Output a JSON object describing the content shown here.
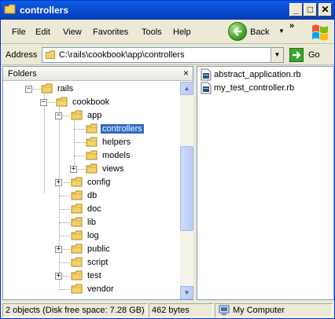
{
  "window": {
    "title": "controllers"
  },
  "title_buttons": {
    "minimize": "_",
    "maximize": "□",
    "close": "✕"
  },
  "menu": {
    "items": [
      "File",
      "Edit",
      "View",
      "Favorites",
      "Tools",
      "Help"
    ]
  },
  "toolbar": {
    "back_label": "Back",
    "more": "»"
  },
  "address": {
    "label": "Address",
    "value": "C:\\rails\\cookbook\\app\\controllers",
    "go_label": "Go"
  },
  "folders": {
    "title": "Folders",
    "close": "×",
    "tree": [
      {
        "label": "rails",
        "expander": "−"
      },
      {
        "label": "cookbook",
        "expander": "−"
      },
      {
        "label": "app",
        "expander": "−"
      },
      {
        "label": "controllers",
        "expander": "",
        "selected": true
      },
      {
        "label": "helpers",
        "expander": ""
      },
      {
        "label": "models",
        "expander": ""
      },
      {
        "label": "views",
        "expander": "+"
      },
      {
        "label": "config",
        "expander": "+"
      },
      {
        "label": "db",
        "expander": ""
      },
      {
        "label": "doc",
        "expander": ""
      },
      {
        "label": "lib",
        "expander": ""
      },
      {
        "label": "log",
        "expander": ""
      },
      {
        "label": "public",
        "expander": "+"
      },
      {
        "label": "script",
        "expander": ""
      },
      {
        "label": "test",
        "expander": "+"
      },
      {
        "label": "vendor",
        "expander": ""
      }
    ]
  },
  "files": [
    {
      "name": "abstract_application.rb"
    },
    {
      "name": "my_test_controller.rb"
    }
  ],
  "status": {
    "objects": "2 objects (Disk free space: 7.28 GB)",
    "size": "462 bytes",
    "location": "My Computer"
  },
  "colors": {
    "title_bar": "#0b4dd3",
    "selection": "#316ac5",
    "folder": "#f3d26b"
  }
}
